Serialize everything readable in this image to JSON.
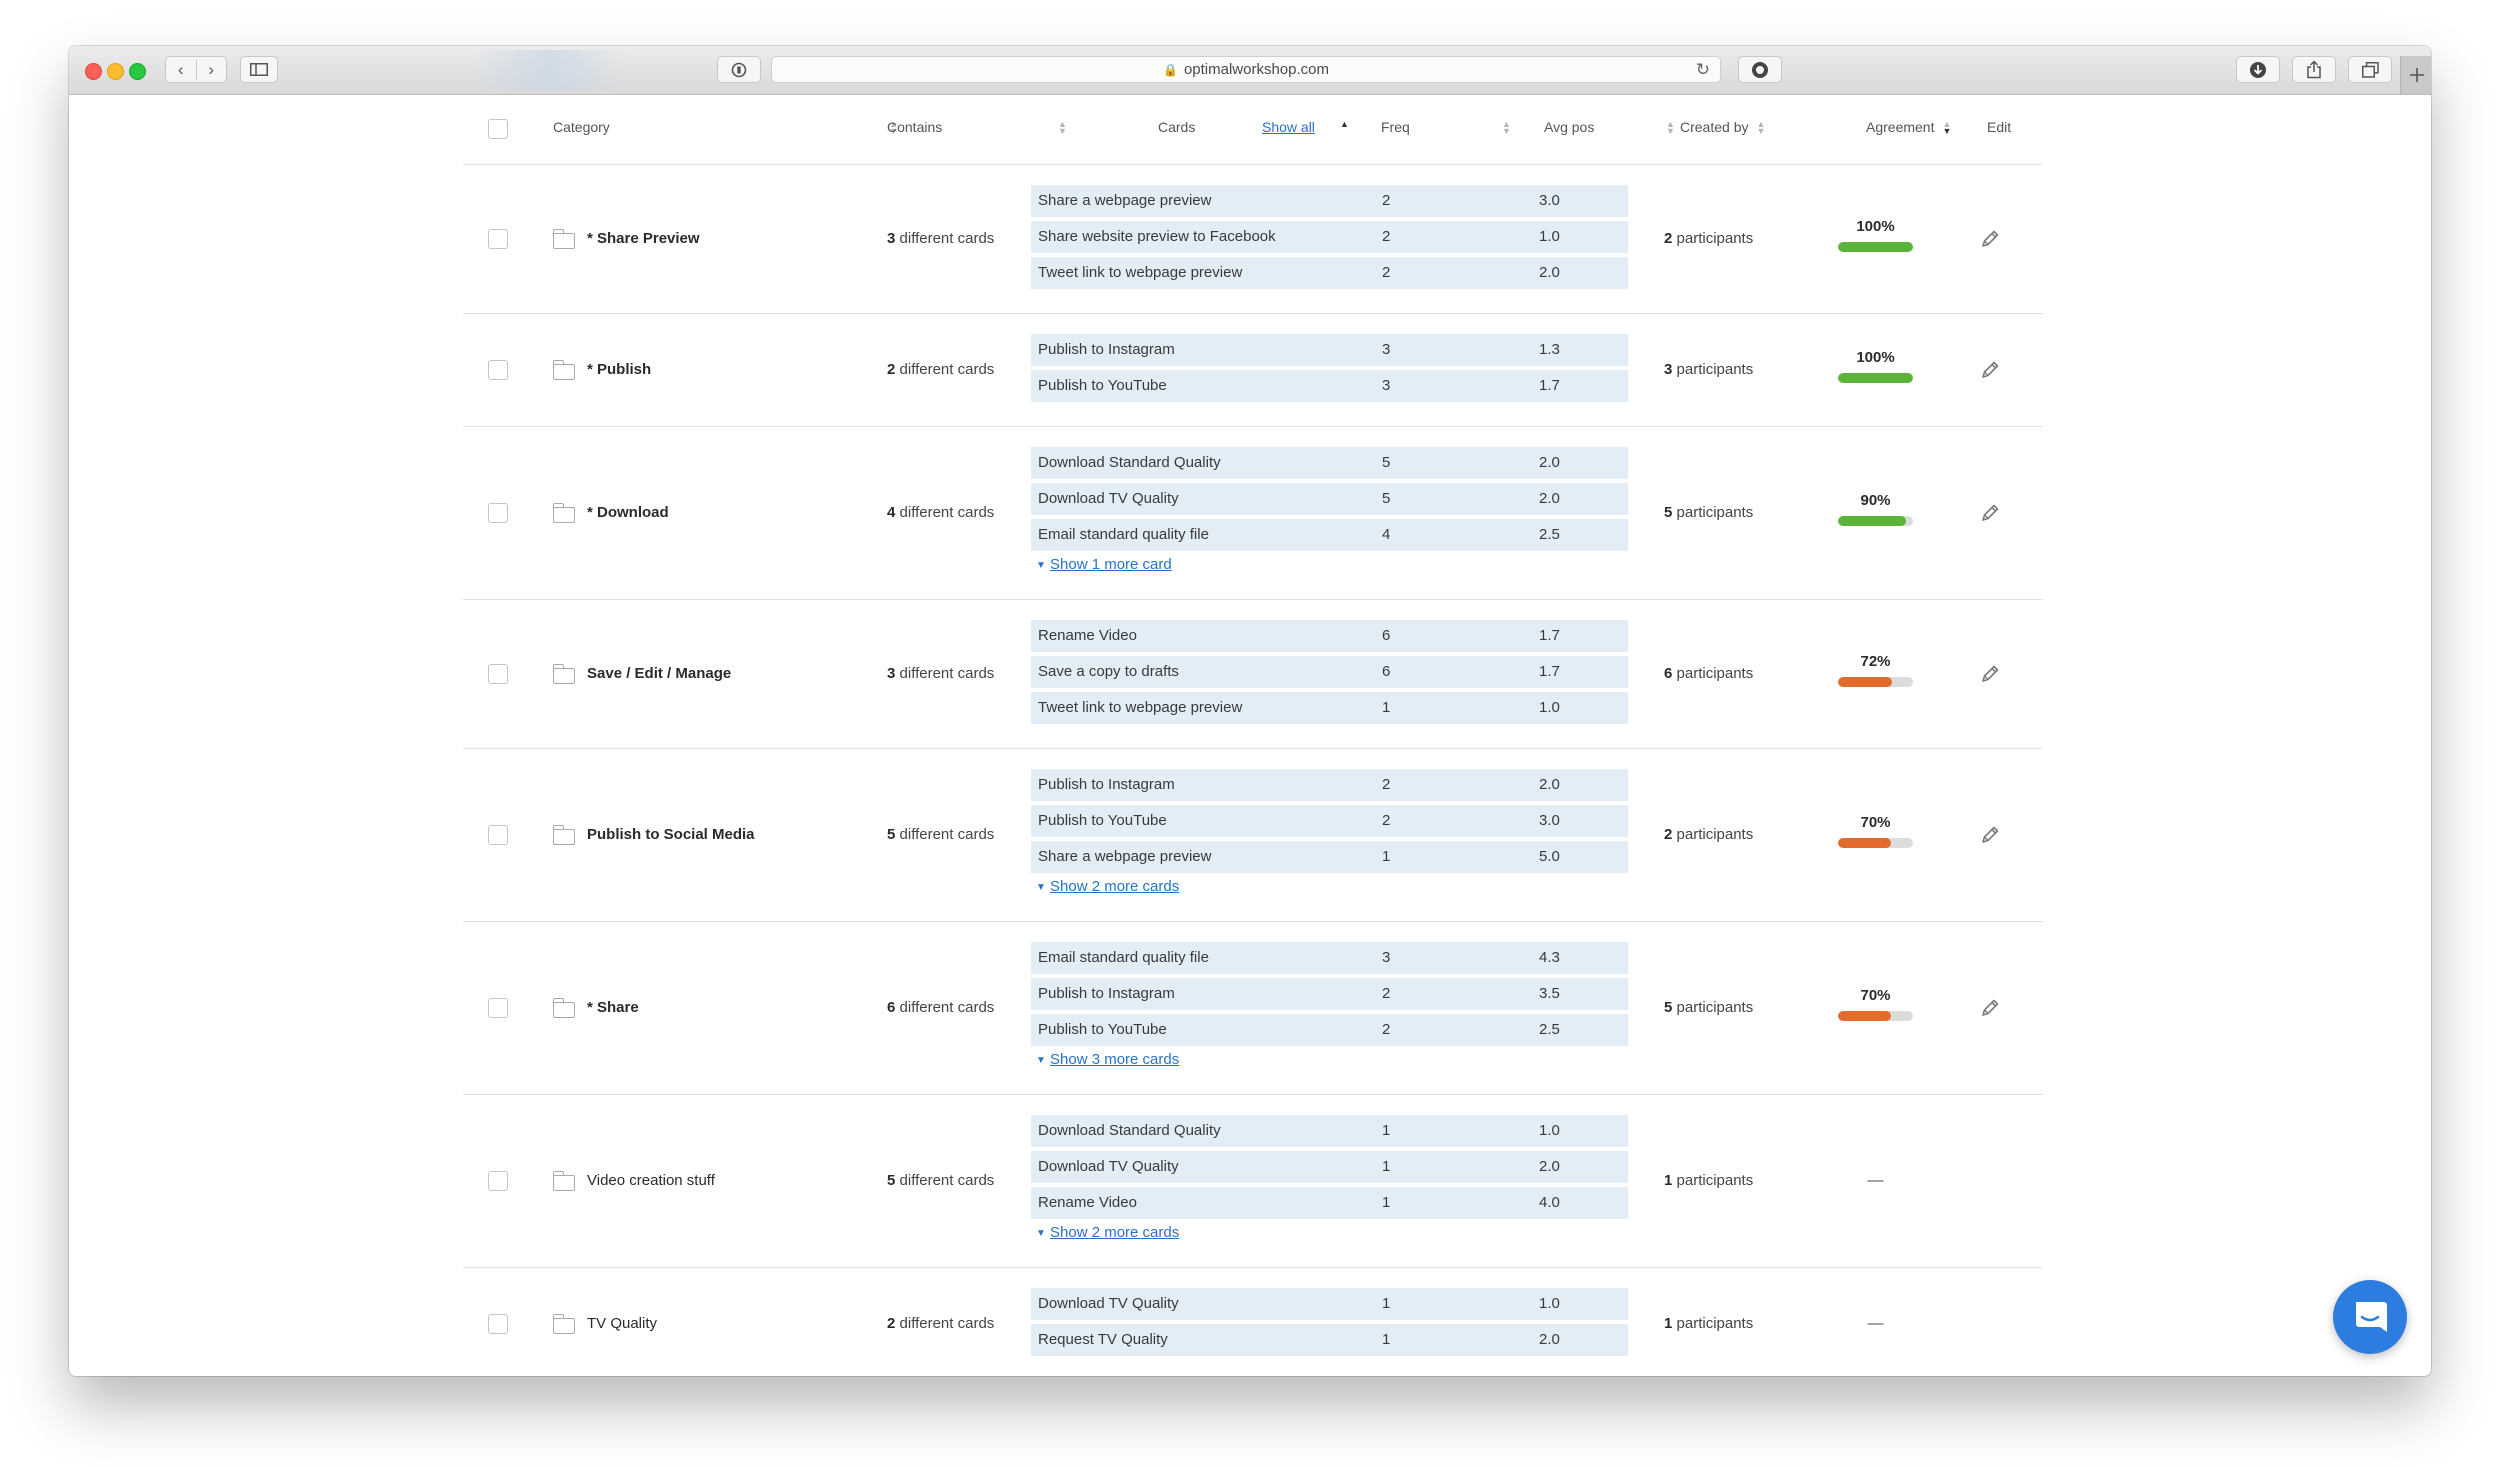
{
  "browser": {
    "url": "optimalworkshop.com",
    "nav_back": "‹",
    "nav_forward": "›"
  },
  "table": {
    "headers": {
      "category": "Category",
      "contains": "Contains",
      "cards": "Cards",
      "show_all": "Show all",
      "freq": "Freq",
      "avg_pos": "Avg pos",
      "created_by": "Created by",
      "agreement": "Agreement",
      "edit": "Edit"
    },
    "rows": [
      {
        "name": "* Share Preview",
        "bold": true,
        "contains_count": "3",
        "contains_label": "different cards",
        "cards": [
          {
            "name": "Share a webpage preview",
            "freq": "2",
            "avg": "3.0"
          },
          {
            "name": "Share website preview to Facebook",
            "freq": "2",
            "avg": "1.0"
          },
          {
            "name": "Tweet link to webpage preview",
            "freq": "2",
            "avg": "2.0"
          }
        ],
        "show_more": "",
        "created_count": "2",
        "created_label": "participants",
        "agreement": "100%",
        "agreement_value": 1.0,
        "agreement_color": "#5bb33a"
      },
      {
        "name": "* Publish",
        "bold": true,
        "contains_count": "2",
        "contains_label": "different cards",
        "cards": [
          {
            "name": "Publish to Instagram",
            "freq": "3",
            "avg": "1.3"
          },
          {
            "name": "Publish to YouTube",
            "freq": "3",
            "avg": "1.7"
          }
        ],
        "show_more": "",
        "created_count": "3",
        "created_label": "participants",
        "agreement": "100%",
        "agreement_value": 1.0,
        "agreement_color": "#5bb33a"
      },
      {
        "name": "* Download",
        "bold": true,
        "contains_count": "4",
        "contains_label": "different cards",
        "cards": [
          {
            "name": "Download Standard Quality",
            "freq": "5",
            "avg": "2.0"
          },
          {
            "name": "Download TV Quality",
            "freq": "5",
            "avg": "2.0"
          },
          {
            "name": "Email standard quality file",
            "freq": "4",
            "avg": "2.5"
          }
        ],
        "show_more": "Show 1 more card",
        "created_count": "5",
        "created_label": "participants",
        "agreement": "90%",
        "agreement_value": 0.9,
        "agreement_color": "#5bb33a"
      },
      {
        "name": "Save / Edit / Manage",
        "bold": true,
        "contains_count": "3",
        "contains_label": "different cards",
        "cards": [
          {
            "name": "Rename Video",
            "freq": "6",
            "avg": "1.7"
          },
          {
            "name": "Save a copy to drafts",
            "freq": "6",
            "avg": "1.7"
          },
          {
            "name": "Tweet link to webpage preview",
            "freq": "1",
            "avg": "1.0"
          }
        ],
        "show_more": "",
        "created_count": "6",
        "created_label": "participants",
        "agreement": "72%",
        "agreement_value": 0.72,
        "agreement_color": "#e36b2c"
      },
      {
        "name": "Publish to Social Media",
        "bold": true,
        "contains_count": "5",
        "contains_label": "different cards",
        "cards": [
          {
            "name": "Publish to Instagram",
            "freq": "2",
            "avg": "2.0"
          },
          {
            "name": "Publish to YouTube",
            "freq": "2",
            "avg": "3.0"
          },
          {
            "name": "Share a webpage preview",
            "freq": "1",
            "avg": "5.0"
          }
        ],
        "show_more": "Show 2 more cards",
        "created_count": "2",
        "created_label": "participants",
        "agreement": "70%",
        "agreement_value": 0.7,
        "agreement_color": "#e36b2c"
      },
      {
        "name": "* Share",
        "bold": true,
        "contains_count": "6",
        "contains_label": "different cards",
        "cards": [
          {
            "name": "Email standard quality file",
            "freq": "3",
            "avg": "4.3"
          },
          {
            "name": "Publish to Instagram",
            "freq": "2",
            "avg": "3.5"
          },
          {
            "name": "Publish to YouTube",
            "freq": "2",
            "avg": "2.5"
          }
        ],
        "show_more": "Show 3 more cards",
        "created_count": "5",
        "created_label": "participants",
        "agreement": "70%",
        "agreement_value": 0.7,
        "agreement_color": "#e36b2c"
      },
      {
        "name": "Video creation stuff",
        "bold": false,
        "contains_count": "5",
        "contains_label": "different cards",
        "cards": [
          {
            "name": "Download Standard Quality",
            "freq": "1",
            "avg": "1.0"
          },
          {
            "name": "Download TV Quality",
            "freq": "1",
            "avg": "2.0"
          },
          {
            "name": "Rename Video",
            "freq": "1",
            "avg": "4.0"
          }
        ],
        "show_more": "Show 2 more cards",
        "created_count": "1",
        "created_label": "participants",
        "agreement": "—",
        "agreement_value": null,
        "agreement_color": ""
      },
      {
        "name": "TV Quality",
        "bold": false,
        "contains_count": "2",
        "contains_label": "different cards",
        "cards": [
          {
            "name": "Download TV Quality",
            "freq": "1",
            "avg": "1.0"
          },
          {
            "name": "Request TV Quality",
            "freq": "1",
            "avg": "2.0"
          }
        ],
        "show_more": "",
        "created_count": "1",
        "created_label": "participants",
        "agreement": "—",
        "agreement_value": null,
        "agreement_color": ""
      }
    ]
  },
  "icons": {
    "folder": "folder-icon",
    "edit": "pencil-icon",
    "chat": "chat-icon"
  }
}
